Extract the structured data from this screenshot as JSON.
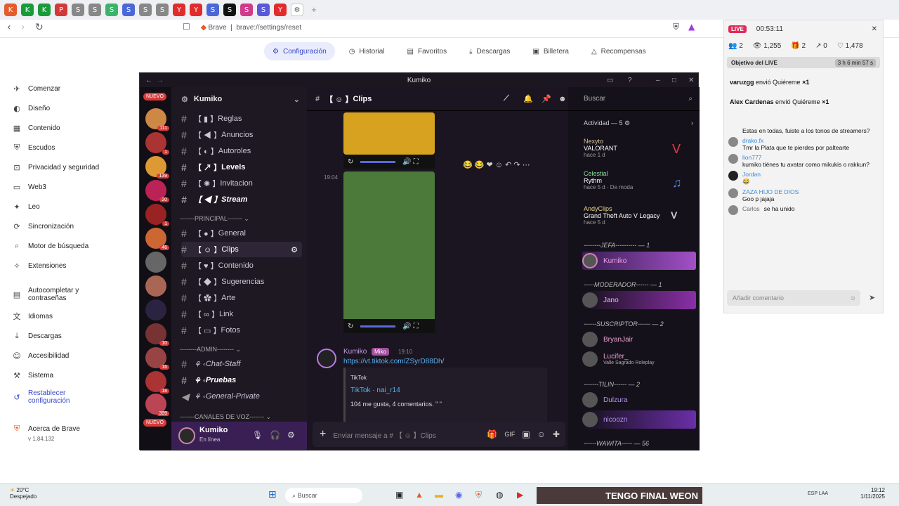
{
  "browser": {
    "tab_icons": [
      "K",
      "K",
      "P",
      "S",
      "S",
      "S",
      "S",
      "Y",
      "Y",
      "S",
      "S",
      "S",
      "S",
      "Y",
      "S"
    ],
    "close_glyph": "✕",
    "address": "brave://settings/reset",
    "site_label": "Brave"
  },
  "settings": {
    "top_tabs": [
      "Configuración",
      "Historial",
      "Favoritos",
      "Descargas",
      "Billetera",
      "Recompensas"
    ],
    "left_nav": [
      "Comenzar",
      "Diseño",
      "Contenido",
      "Escudos",
      "Privacidad y seguridad",
      "Web3",
      "Leo",
      "Sincronización",
      "Motor de búsqueda",
      "Extensiones",
      "Autocompletar y contraseñas",
      "Idiomas",
      "Descargas",
      "Accesibilidad",
      "Sistema",
      "Restablecer configuración",
      "Acerca de Brave"
    ],
    "version": "v 1.84.132"
  },
  "discord": {
    "window_title": "Kumiko",
    "server_name": "Kumiko",
    "server_badges": [
      "NUEVO",
      "111",
      "1",
      "139",
      "20",
      "1",
      "46",
      "",
      "",
      "10",
      "16",
      "18",
      "399",
      "NUEVO"
    ],
    "channels": [
      "Reglas",
      "Anuncios",
      "Autoroles",
      "Levels",
      "Invitacion",
      "Stream",
      "General",
      "Clips",
      "Contenido",
      "Sugerencias",
      "Arte",
      "Link",
      "Fotos"
    ],
    "categories": [
      "-------PRINCIPAL------- ⌄",
      "--------ADMIN-------- ⌄",
      "-------CANALES DE VOZ------- ⌄"
    ],
    "admin_channels": [
      "Chat-Staff",
      "Pruebas",
      "General-Private"
    ],
    "current_channel": "Clips",
    "search_placeholder": "Buscar",
    "message_time": "19:04",
    "msg_author": "Kumiko",
    "msg_tag": "Miko",
    "msg_time": "19:10",
    "msg_link": "https://vt.tiktok.com/ZSyrD88Dh/",
    "embed_provider": "TikTok",
    "embed_title": "TikTok · nai_r14",
    "embed_desc": "104 me gusta, 4 comentarios. \" \"",
    "composer_placeholder": "Enviar mensaje a # 【 ☺ 】Clips",
    "user_name": "Kumiko",
    "user_status": "En línea",
    "activity_header": "Actividad — 5",
    "activities": [
      {
        "name": "Nexyto",
        "game": "VALORANT",
        "time": "hace 1 d"
      },
      {
        "name": "Celestial",
        "game": "Rythm",
        "time": "hace 5 d · De moda"
      },
      {
        "name": "AndyClips",
        "game": "Grand Theft Auto V Legacy",
        "time": "hace 5 d"
      }
    ],
    "roles": [
      {
        "title": "--------JEFA---------- — 1",
        "members": [
          "Kumiko"
        ]
      },
      {
        "title": "-----MODERADOR------ — 1",
        "members": [
          "Jano"
        ]
      },
      {
        "title": "------SUSCRIPTOR------ — 2",
        "members": [
          "BryanJair",
          "Lucifer_"
        ]
      },
      {
        "title": "-------TILIN------ — 2",
        "members": [
          "Dulzura",
          "nicoozn"
        ]
      },
      {
        "title": "------WAWITA----- — 56",
        "members": []
      }
    ],
    "lucifer_sub": "Valle Sagrado Roleplay"
  },
  "live": {
    "badge": "LIVE",
    "timer": "00:53:11",
    "stats": [
      "2",
      "1,255",
      "2",
      "0",
      "1,478"
    ],
    "objective": "Objetivo del LIVE",
    "objective_time": "3 h 6 min 57 s",
    "gifts": [
      {
        "user": "varuzgg",
        "text": "envió Quiéreme",
        "count": "×1"
      },
      {
        "user": "Alex Cardenas",
        "text": "envió Quiéreme",
        "count": "×1"
      }
    ],
    "comments": [
      {
        "user": "",
        "text": "Estas en todas, fuiste a los tonos de streamers?"
      },
      {
        "user": "drako.fx",
        "text": "Tmr la Plata que te pierdes por paltearte"
      },
      {
        "user": "lion777",
        "text": "kumiko tiénes tu avatar como mikukis o rakkun?"
      },
      {
        "user": "Jordan",
        "text": "😂"
      },
      {
        "user": "ZAZA HIJO DE DIOS",
        "text": "Goo p jajaja"
      },
      {
        "user": "Carlos",
        "text": "se ha unido"
      }
    ],
    "comment_placeholder": "Añadir comentario"
  },
  "taskbar": {
    "temp": "20°C",
    "weather": "Despejado",
    "search": "Buscar",
    "banner": "TENGO FINAL WEON",
    "lang": "ESP LAA",
    "time": "19:12",
    "date": "1/11/2025"
  }
}
